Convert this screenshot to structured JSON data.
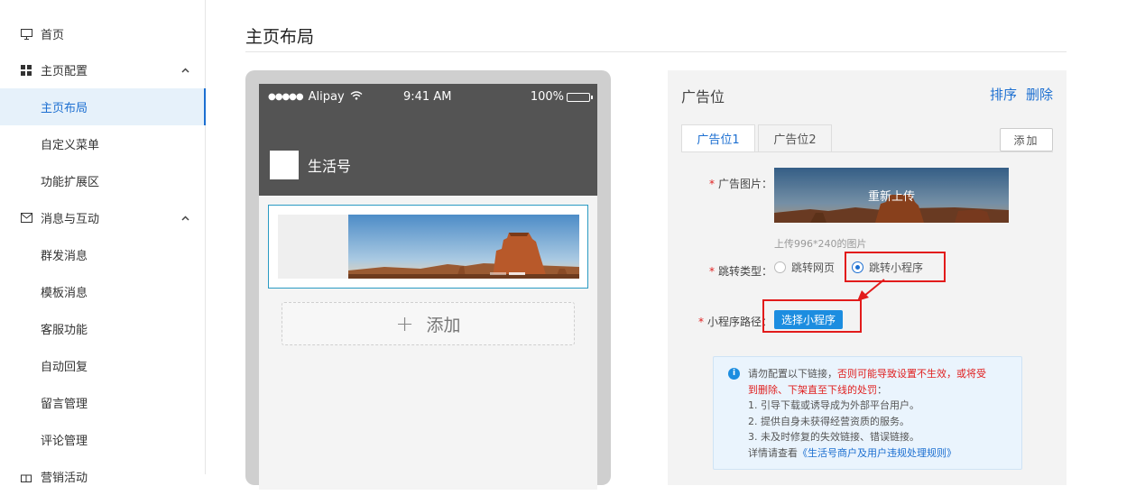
{
  "sidebar": {
    "items": [
      {
        "label": "首页",
        "icon": "monitor-icon"
      },
      {
        "label": "主页配置",
        "icon": "grid-icon",
        "chevron": "^"
      },
      {
        "label": "主页布局",
        "active": true
      },
      {
        "label": "自定义菜单"
      },
      {
        "label": "功能扩展区"
      },
      {
        "label": "消息与互动",
        "icon": "mail-icon",
        "chevron": "^"
      },
      {
        "label": "群发消息"
      },
      {
        "label": "模板消息"
      },
      {
        "label": "客服功能"
      },
      {
        "label": "自动回复"
      },
      {
        "label": "留言管理"
      },
      {
        "label": "评论管理"
      },
      {
        "label": "营销活动",
        "icon": "gift-icon"
      }
    ]
  },
  "page": {
    "title": "主页布局"
  },
  "phone": {
    "carrier": "Alipay",
    "time": "9:41 AM",
    "battery": "100%",
    "account_name": "生活号",
    "add_label": "添加"
  },
  "panel": {
    "title": "广告位",
    "sort_label": "排序",
    "delete_label": "删除",
    "tabs": [
      "广告位1",
      "广告位2"
    ],
    "add_button": "添加",
    "image_label": "广告图片：",
    "reupload_label": "重新上传",
    "upload_hint": "上传996*240的图片",
    "jump_label": "跳转类型：",
    "jump_options": [
      "跳转网页",
      "跳转小程序"
    ],
    "path_label": "小程序路径：",
    "select_button": "选择小程序",
    "required_mark": "*"
  },
  "notice": {
    "line1_a": "请勿配置以下链接，",
    "line1_b": "否则可能导致设置不生效，或将受",
    "line2_b": "到删除、下架直至下线的处罚",
    "line2_c": "：",
    "item1": "1. 引导下载或诱导成为外部平台用户。",
    "item2": "2. 提供自身未获得经营资质的服务。",
    "item3": "3. 未及时修复的失效链接、错误链接。",
    "more_a": "详情请查看",
    "more_link": "《生活号商户及用户违规处理规则》"
  },
  "colors": {
    "accent": "#1c6fd1",
    "highlight_box": "#e21b1b",
    "header_dark": "#545454"
  }
}
